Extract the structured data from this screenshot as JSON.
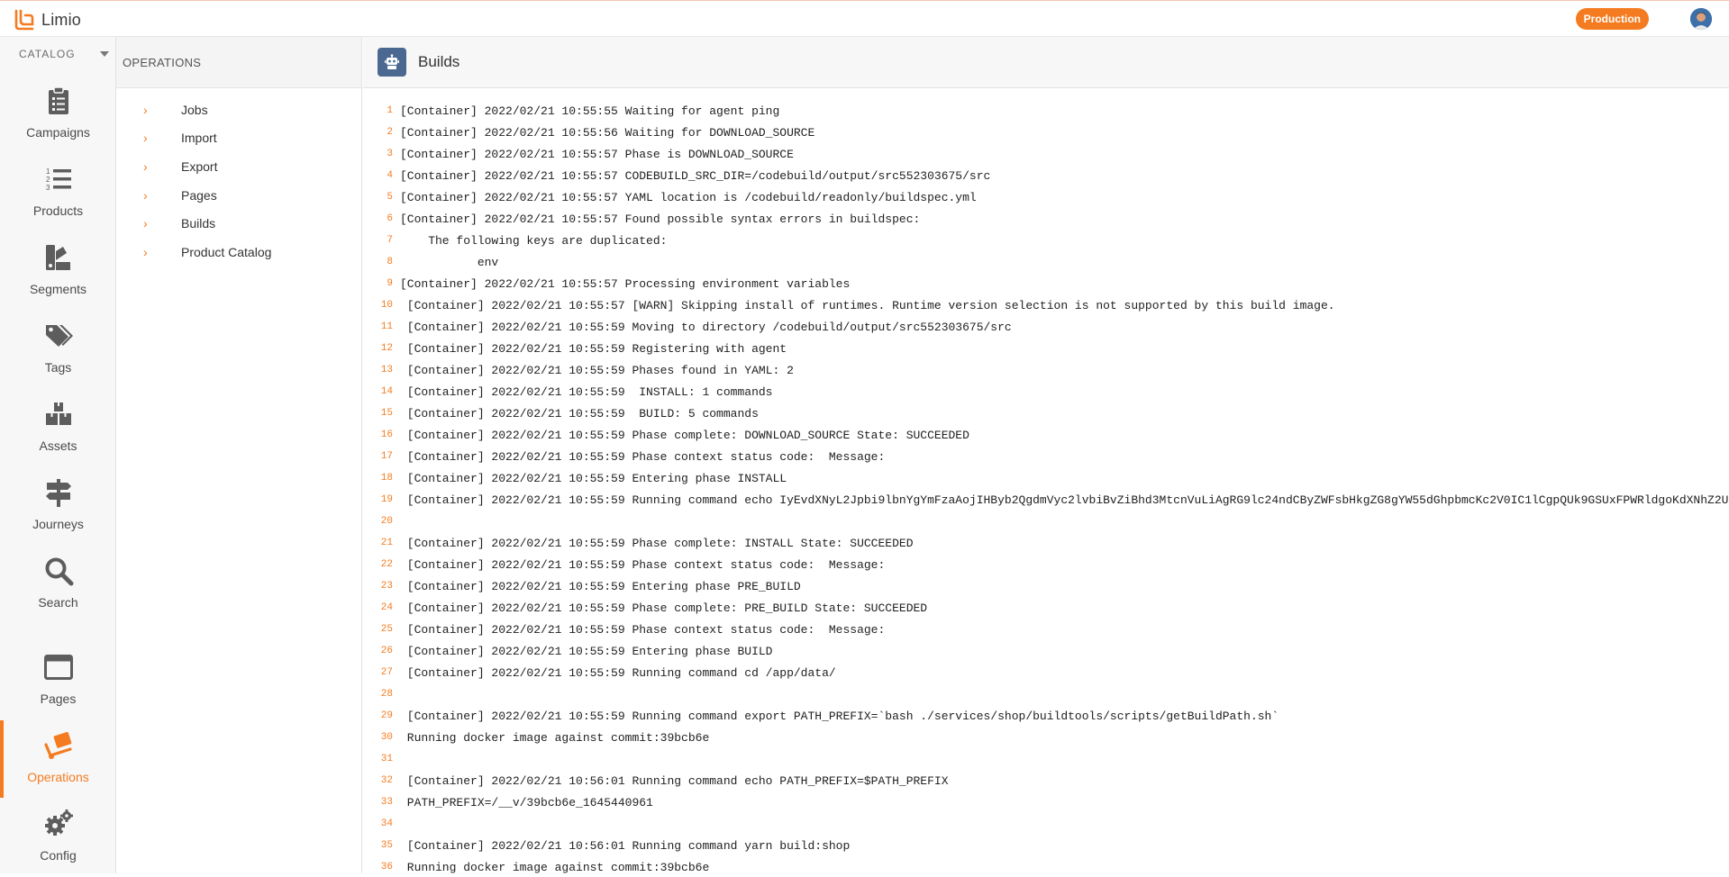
{
  "app": {
    "name": "Limio",
    "environment": "Production"
  },
  "rail": {
    "header": "CATALOG",
    "items": [
      {
        "label": "Campaigns",
        "icon": "clipboard-icon"
      },
      {
        "label": "Products",
        "icon": "numbered-list-icon"
      },
      {
        "label": "Segments",
        "icon": "segments-icon"
      },
      {
        "label": "Tags",
        "icon": "tags-icon"
      },
      {
        "label": "Assets",
        "icon": "boxes-icon"
      },
      {
        "label": "Journeys",
        "icon": "signpost-icon"
      },
      {
        "label": "Search",
        "icon": "search-icon"
      },
      {
        "label": "Pages",
        "icon": "browser-window-icon"
      },
      {
        "label": "Operations",
        "icon": "hand-truck-icon"
      },
      {
        "label": "Config",
        "icon": "gears-icon"
      }
    ],
    "active": "Operations"
  },
  "subnav": {
    "header": "OPERATIONS",
    "items": [
      "Jobs",
      "Import",
      "Export",
      "Pages",
      "Builds",
      "Product Catalog"
    ]
  },
  "main": {
    "title": "Builds",
    "title_icon": "robot-icon"
  },
  "log": [
    "[Container] 2022/02/21 10:55:55 Waiting for agent ping",
    "[Container] 2022/02/21 10:55:56 Waiting for DOWNLOAD_SOURCE",
    "[Container] 2022/02/21 10:55:57 Phase is DOWNLOAD_SOURCE",
    "[Container] 2022/02/21 10:55:57 CODEBUILD_SRC_DIR=/codebuild/output/src552303675/src",
    "[Container] 2022/02/21 10:55:57 YAML location is /codebuild/readonly/buildspec.yml",
    "[Container] 2022/02/21 10:55:57 Found possible syntax errors in buildspec:",
    "    The following keys are duplicated:",
    "           env",
    "[Container] 2022/02/21 10:55:57 Processing environment variables",
    " [Container] 2022/02/21 10:55:57 [WARN] Skipping install of runtimes. Runtime version selection is not supported by this build image.",
    " [Container] 2022/02/21 10:55:59 Moving to directory /codebuild/output/src552303675/src",
    " [Container] 2022/02/21 10:55:59 Registering with agent",
    " [Container] 2022/02/21 10:55:59 Phases found in YAML: 2",
    " [Container] 2022/02/21 10:55:59  INSTALL: 1 commands",
    " [Container] 2022/02/21 10:55:59  BUILD: 5 commands",
    " [Container] 2022/02/21 10:55:59 Phase complete: DOWNLOAD_SOURCE State: SUCCEEDED",
    " [Container] 2022/02/21 10:55:59 Phase context status code:  Message:",
    " [Container] 2022/02/21 10:55:59 Entering phase INSTALL",
    " [Container] 2022/02/21 10:55:59 Running command echo IyEvdXNyL2Jpbi9lbnYgYmFzaAojIHByb2QgdmVyc2lvbiBvZiBhd3MtcnVuLiAgRG9lc24ndCByZWFsbHkgZG8gYW55dGhpbmcKc2V0IC1lCgpQUk9GSUxFPWRldgoKdXNhZ2U",
    "",
    " [Container] 2022/02/21 10:55:59 Phase complete: INSTALL State: SUCCEEDED",
    " [Container] 2022/02/21 10:55:59 Phase context status code:  Message:",
    " [Container] 2022/02/21 10:55:59 Entering phase PRE_BUILD",
    " [Container] 2022/02/21 10:55:59 Phase complete: PRE_BUILD State: SUCCEEDED",
    " [Container] 2022/02/21 10:55:59 Phase context status code:  Message:",
    " [Container] 2022/02/21 10:55:59 Entering phase BUILD",
    " [Container] 2022/02/21 10:55:59 Running command cd /app/data/",
    "",
    " [Container] 2022/02/21 10:55:59 Running command export PATH_PREFIX=`bash ./services/shop/buildtools/scripts/getBuildPath.sh`",
    " Running docker image against commit:39bcb6e",
    "",
    " [Container] 2022/02/21 10:56:01 Running command echo PATH_PREFIX=$PATH_PREFIX",
    " PATH_PREFIX=/__v/39bcb6e_1645440961",
    "",
    " [Container] 2022/02/21 10:56:01 Running command yarn build:shop",
    " Running docker image against commit:39bcb6e"
  ]
}
